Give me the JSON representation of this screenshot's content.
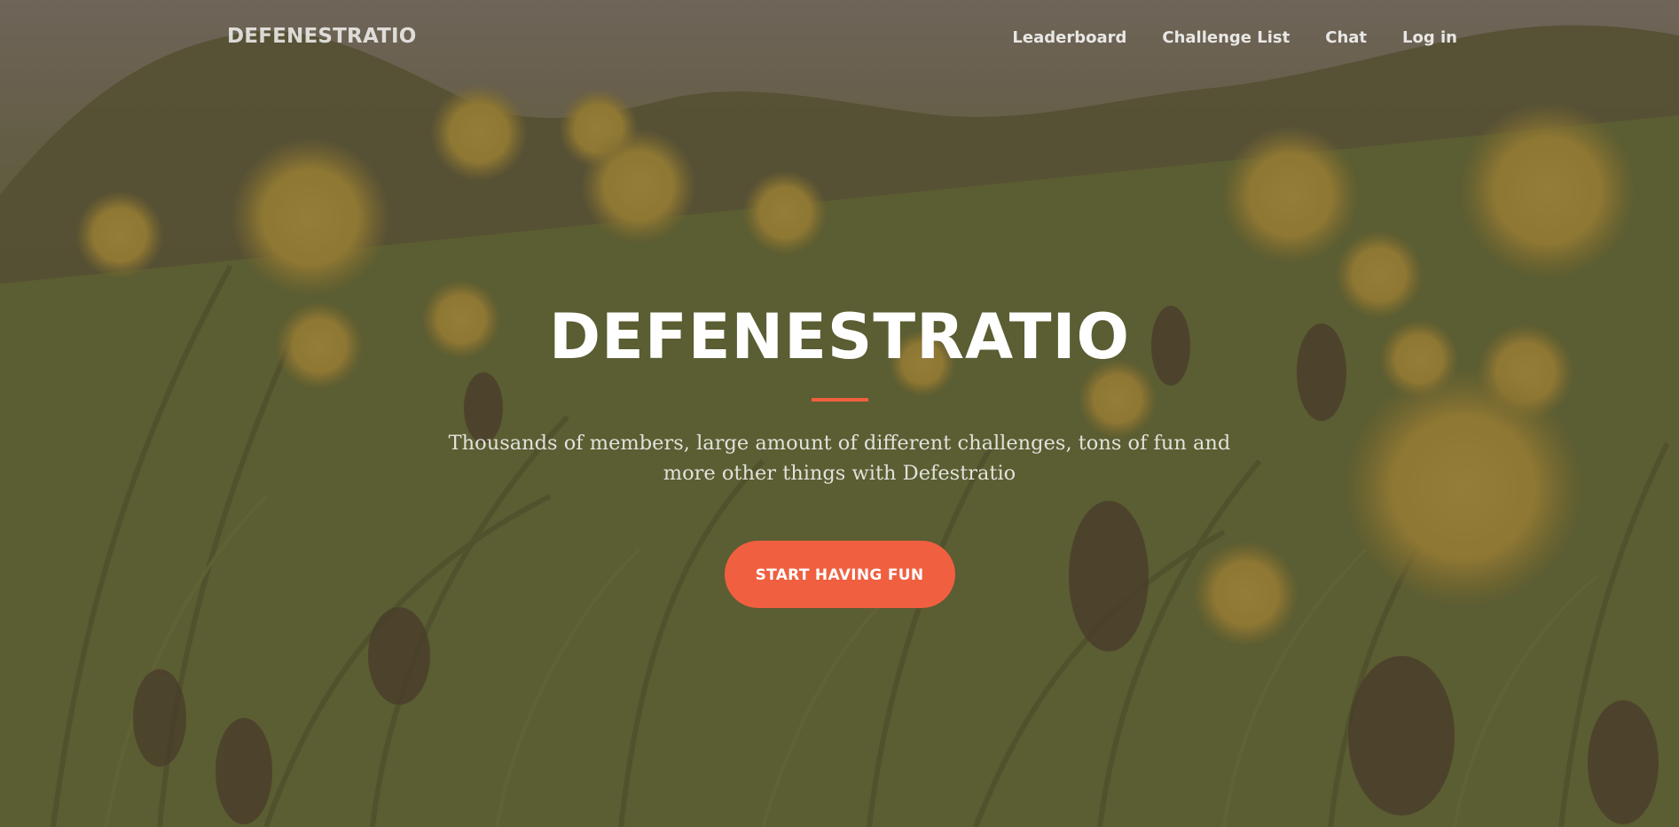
{
  "navbar": {
    "brand": "DEFENESTRATIO",
    "links": [
      {
        "label": "Leaderboard"
      },
      {
        "label": "Challenge List"
      },
      {
        "label": "Chat"
      },
      {
        "label": "Log in"
      }
    ]
  },
  "hero": {
    "title": "DEFENESTRATIO",
    "subtitle": "Thousands of members, large amount of different challenges, tons of fun and more other things with Defestratio",
    "cta_label": "START HAVING FUN"
  },
  "colors": {
    "accent": "#f05f40",
    "overlay": "#5c4838",
    "text": "#ffffff"
  },
  "background": {
    "description_icon": "dandelion-field-photo"
  }
}
